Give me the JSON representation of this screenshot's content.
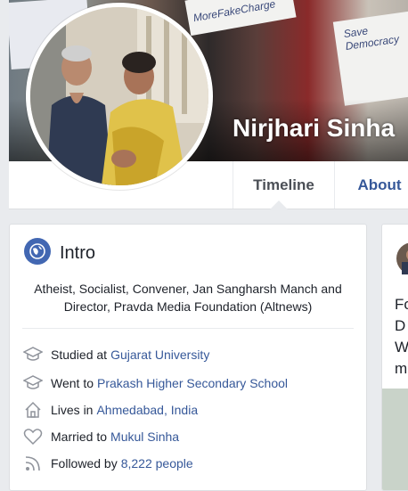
{
  "profile": {
    "name": "Nirjhari Sinha"
  },
  "cover": {
    "sign_text": "MoreFakeCharge",
    "sign_text_2": "Save Democracy"
  },
  "nav": {
    "tabs": [
      {
        "label": "Timeline"
      },
      {
        "label": "About"
      }
    ]
  },
  "intro": {
    "title": "Intro",
    "bio": "Atheist, Socialist, Convener, Jan Sangharsh Manch and Director, Pravda Media Foundation (Altnews)",
    "items": [
      {
        "icon": "graduation-cap-icon",
        "prefix": "Studied at",
        "link": "Gujarat University"
      },
      {
        "icon": "graduation-cap-icon",
        "prefix": "Went to",
        "link": "Prakash Higher Secondary School"
      },
      {
        "icon": "home-icon",
        "prefix": "Lives in",
        "link": "Ahmedabad, India"
      },
      {
        "icon": "heart-icon",
        "prefix": "Married to",
        "link": "Mukul Sinha"
      },
      {
        "icon": "rss-icon",
        "prefix": "Followed by",
        "link": "8,222 people"
      }
    ]
  },
  "right_card": {
    "lines": [
      "Fo",
      "D",
      "W",
      "m"
    ]
  },
  "colors": {
    "link": "#365899",
    "text": "#1d2129",
    "background": "#e9ebee",
    "intro_icon": "#4267b2"
  }
}
